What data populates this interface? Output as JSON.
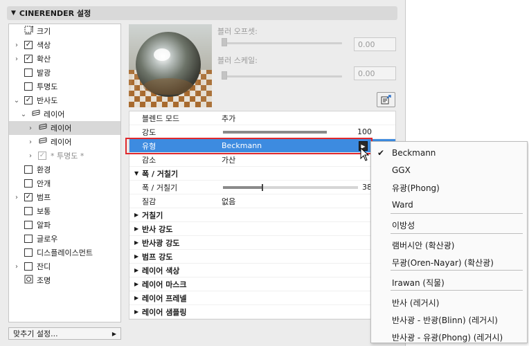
{
  "panel": {
    "title": "CINERENDER 설정",
    "preset_label": "맞추기 설정..."
  },
  "tree": [
    {
      "label": "크기",
      "chev": "",
      "check": "none",
      "icon": "size-icon",
      "indent": 0,
      "dim": false,
      "selected": false
    },
    {
      "label": "색상",
      "chev": "›",
      "check": "checked",
      "indent": 0,
      "dim": false,
      "selected": false
    },
    {
      "label": "확산",
      "chev": "›",
      "check": "checked",
      "indent": 0,
      "dim": false,
      "selected": false
    },
    {
      "label": "발광",
      "chev": "",
      "check": "unchecked",
      "indent": 0,
      "dim": false,
      "selected": false
    },
    {
      "label": "투명도",
      "chev": "",
      "check": "unchecked",
      "indent": 0,
      "dim": false,
      "selected": false
    },
    {
      "label": "반사도",
      "chev": "⌄",
      "check": "checked",
      "indent": 0,
      "dim": false,
      "selected": false
    },
    {
      "label": "레이어",
      "chev": "⌄",
      "check": "layers",
      "indent": 1,
      "dim": false,
      "selected": false
    },
    {
      "label": "레이어",
      "chev": "›",
      "check": "layers",
      "indent": 2,
      "dim": false,
      "selected": true
    },
    {
      "label": "레이어",
      "chev": "›",
      "check": "layers",
      "indent": 2,
      "dim": false,
      "selected": false
    },
    {
      "label": "* 투명도 *",
      "chev": "›",
      "check": "checked-dim",
      "indent": 2,
      "dim": true,
      "selected": false
    },
    {
      "label": "환경",
      "chev": "",
      "check": "unchecked",
      "indent": 0,
      "dim": false,
      "selected": false
    },
    {
      "label": "안개",
      "chev": "",
      "check": "unchecked",
      "indent": 0,
      "dim": false,
      "selected": false
    },
    {
      "label": "범프",
      "chev": "›",
      "check": "checked",
      "indent": 0,
      "dim": false,
      "selected": false
    },
    {
      "label": "보통",
      "chev": "",
      "check": "unchecked",
      "indent": 0,
      "dim": false,
      "selected": false
    },
    {
      "label": "알파",
      "chev": "",
      "check": "unchecked",
      "indent": 0,
      "dim": false,
      "selected": false
    },
    {
      "label": "글로우",
      "chev": "",
      "check": "unchecked",
      "indent": 0,
      "dim": false,
      "selected": false
    },
    {
      "label": "디스플레이스먼트",
      "chev": "",
      "check": "unchecked",
      "indent": 0,
      "dim": false,
      "selected": false
    },
    {
      "label": "잔디",
      "chev": "›",
      "check": "unchecked",
      "indent": 0,
      "dim": false,
      "selected": false
    },
    {
      "label": "조명",
      "chev": "",
      "check": "none",
      "icon": "light-icon",
      "indent": 0,
      "dim": false,
      "selected": false
    }
  ],
  "blur": {
    "offset_label": "블러 오프셋:",
    "offset_value": "0.00",
    "scale_label": "블러 스케일:",
    "scale_value": "0.00"
  },
  "props": {
    "blend_mode": {
      "name": "블렌드 모드",
      "value": "추가"
    },
    "strength": {
      "name": "강도",
      "value": "100"
    },
    "type": {
      "name": "유형",
      "value": "Beckmann"
    },
    "attenuation": {
      "name": "감소",
      "value": "가산"
    },
    "roughness_section": "폭 / 거칠기",
    "roughness": {
      "name": "폭 / 거칠기",
      "value": "38"
    },
    "texture": {
      "name": "질감",
      "value": "없음"
    },
    "sections": [
      "거칠기",
      "반사 강도",
      "반사광 강도",
      "범프 강도",
      "레이어 색상",
      "레이어 마스크",
      "레이어 프레넬",
      "레이어 샘플링"
    ]
  },
  "menu": {
    "items": [
      {
        "label": "Beckmann",
        "checked": true
      },
      {
        "label": "GGX",
        "checked": false
      },
      {
        "label": "유광(Phong)",
        "checked": false
      },
      {
        "label": "Ward",
        "checked": false
      },
      {
        "label": "이방성",
        "checked": false
      },
      {
        "label": "램버시안 (확산광)",
        "checked": false
      },
      {
        "label": "무광(Oren-Nayar) (확산광)",
        "checked": false
      },
      {
        "label": "Irawan (직물)",
        "checked": false
      },
      {
        "label": "반사 (레거시)",
        "checked": false
      },
      {
        "label": "반사광 - 반광(Blinn) (레거시)",
        "checked": false
      },
      {
        "label": "반사광 - 유광(Phong) (레거시)",
        "checked": false
      }
    ]
  },
  "colors": {
    "highlight": "#3d8be0",
    "annotation": "#e0282c"
  }
}
